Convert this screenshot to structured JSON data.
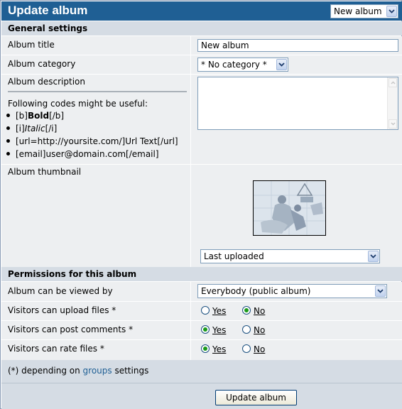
{
  "header": {
    "title": "Update album",
    "album_select": "New album"
  },
  "sections": {
    "general": "General settings",
    "permissions": "Permissions for this album"
  },
  "fields": {
    "album_title_label": "Album title",
    "album_title_value": "New album",
    "album_category_label": "Album category",
    "album_category_value": "* No category *",
    "album_description_label": "Album description",
    "album_description_value": "",
    "codes_intro": "Following codes might be useful:",
    "codes": {
      "bold_open": "[b]",
      "bold_text": "Bold",
      "bold_close": "[/b]",
      "italic_open": "[i]",
      "italic_text": "Italic",
      "italic_close": "[/i]",
      "url": "[url=http://yoursite.com/]Url Text[/url]",
      "email": "[email]user@domain.com[/email]"
    },
    "album_thumbnail_label": "Album thumbnail",
    "album_thumbnail_value": "Last uploaded"
  },
  "permissions": {
    "viewed_by_label": "Album can be viewed by",
    "viewed_by_value": "Everybody (public album)",
    "upload_label": "Visitors can upload files *",
    "comments_label": "Visitors can post comments *",
    "rate_label": "Visitors can rate files *",
    "yes": "Yes",
    "no": "No",
    "upload_selected": "No",
    "comments_selected": "Yes",
    "rate_selected": "Yes"
  },
  "footer": {
    "note_prefix": "(*) depending on ",
    "note_link": "groups",
    "note_suffix": " settings",
    "submit": "Update album"
  },
  "colors": {
    "title_bar": "#1f5f94",
    "section_bg": "#d5dce4",
    "row_bg": "#edeff1",
    "link": "#1f5f94",
    "radio_selected": "#1a9a1a"
  }
}
